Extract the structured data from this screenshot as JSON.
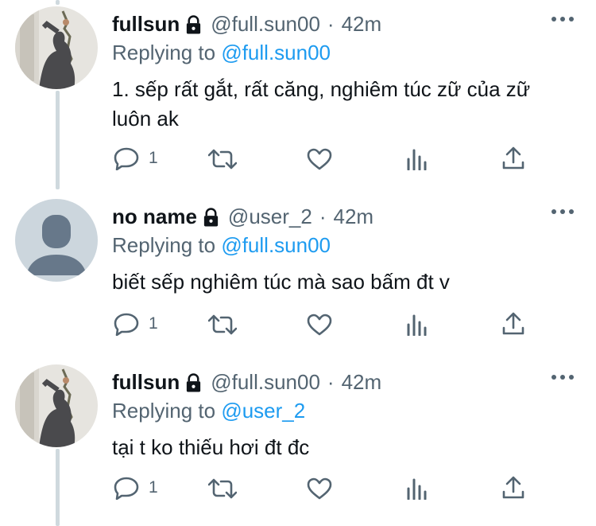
{
  "tweets": [
    {
      "name": "fullsun",
      "handle": "@full.sun00",
      "time": "42m",
      "replying_prefix": "Replying to",
      "replying_to": "@full.sun00",
      "text": "1. sếp rất gắt, rất căng, nghiêm túc zữ của zữ luôn ak",
      "reply_count": "1",
      "avatar": "photo-shadow"
    },
    {
      "name": "no name",
      "handle": "@user_2",
      "time": "42m",
      "replying_prefix": "Replying to",
      "replying_to": "@full.sun00",
      "text": "biết sếp nghiêm túc mà sao bấm đt v",
      "reply_count": "1",
      "avatar": "default-avatar"
    },
    {
      "name": "fullsun",
      "handle": "@full.sun00",
      "time": "42m",
      "replying_prefix": "Replying to",
      "replying_to": "@user_2",
      "text": "tại t ko thiếu hơi đt đc",
      "reply_count": "1",
      "avatar": "photo-shadow"
    }
  ],
  "separator": "·",
  "icons": {
    "lock": "lock-icon",
    "more": "more-icon",
    "reply": "reply-icon",
    "retweet": "retweet-icon",
    "like": "heart-icon",
    "views": "analytics-icon",
    "share": "share-icon"
  },
  "colors": {
    "text": "#0f1419",
    "muted": "#536471",
    "link": "#1d9bf0",
    "thread_line": "#cfd9de"
  }
}
